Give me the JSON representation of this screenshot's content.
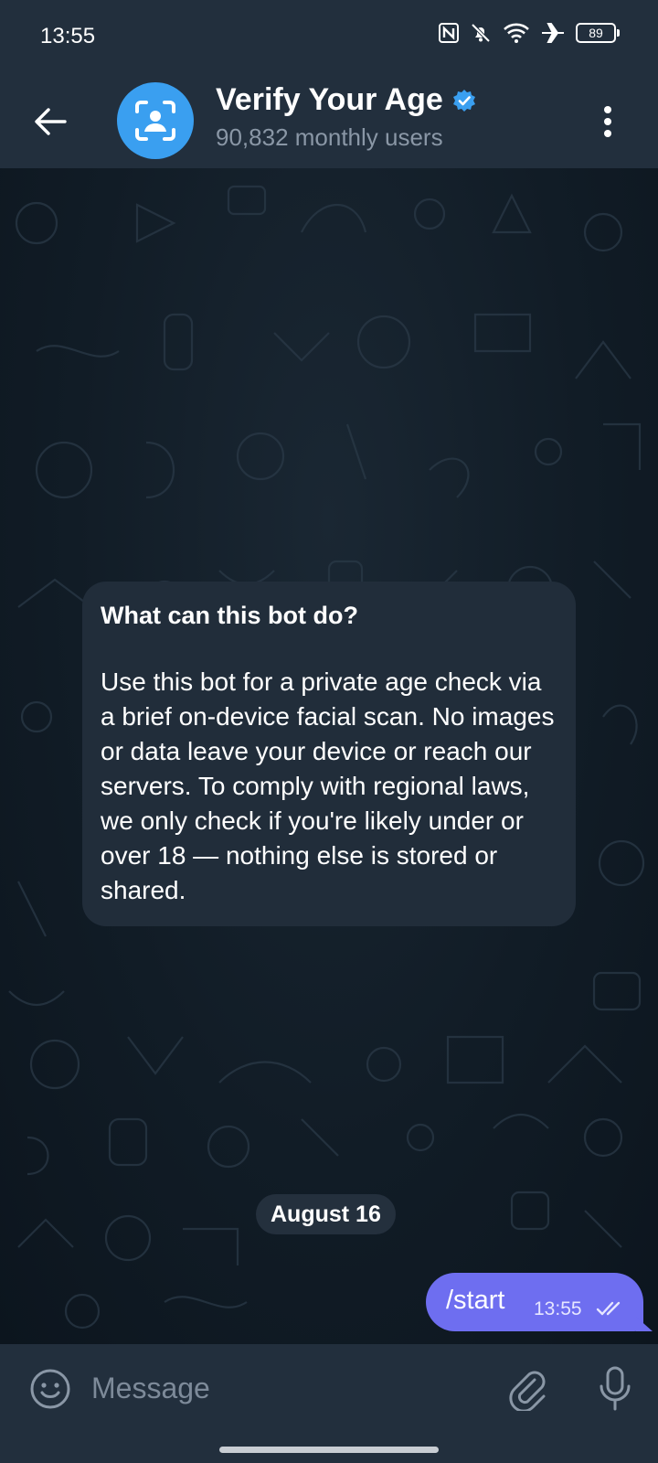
{
  "status_bar": {
    "time": "13:55",
    "battery": "89",
    "icons": [
      "nfc-icon",
      "bell-muted-icon",
      "wifi-icon",
      "airplane-icon",
      "battery-icon"
    ]
  },
  "header": {
    "title": "Verify Your Age",
    "subtitle": "90,832 monthly users",
    "verified": true,
    "icons": [
      "back-arrow-icon",
      "face-scan-icon",
      "verified-badge-icon",
      "more-vertical-icon"
    ]
  },
  "bot_info": {
    "title": "What can this bot do?",
    "body": "Use this bot for a private age check via a brief on-device facial scan. No images or data leave your device or reach our servers. To comply with regional laws, we only check if you're likely under or over 18 — nothing else is stored or shared."
  },
  "date_separator": "August 16",
  "messages": [
    {
      "text": "/start",
      "time": "13:55",
      "outgoing": true,
      "status": "read"
    }
  ],
  "composer": {
    "placeholder": "Message",
    "value": "",
    "icons": [
      "emoji-icon",
      "paperclip-icon",
      "microphone-icon"
    ]
  },
  "colors": {
    "header_bg": "#222f3d",
    "bubble_in": "#212d3a",
    "bubble_out": "#6e6ef0",
    "accent": "#3a9ff0"
  }
}
